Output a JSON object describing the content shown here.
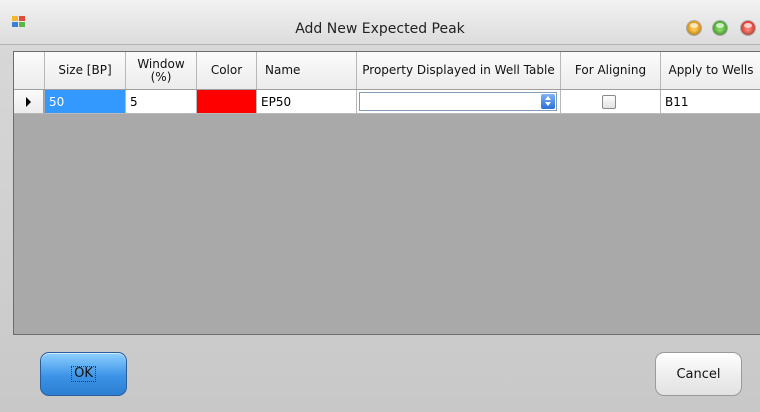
{
  "window": {
    "title": "Add New Expected Peak",
    "accent_color": "#3399ff"
  },
  "icons": {
    "app": "app-icon",
    "minimize": "minimize-icon",
    "maximize": "maximize-icon",
    "close": "close-icon"
  },
  "table": {
    "columns": [
      "Size [BP]",
      "Window\n(%)",
      "Color",
      "Name",
      "Property Displayed in Well Table",
      "For Aligning",
      "Apply to Wells"
    ],
    "row": {
      "size": "50",
      "window": "5",
      "color": "#ff0000",
      "name": "EP50",
      "property": "",
      "for_aligning": false,
      "apply_to_wells": "B11"
    }
  },
  "buttons": {
    "ok": "OK",
    "cancel": "Cancel"
  }
}
